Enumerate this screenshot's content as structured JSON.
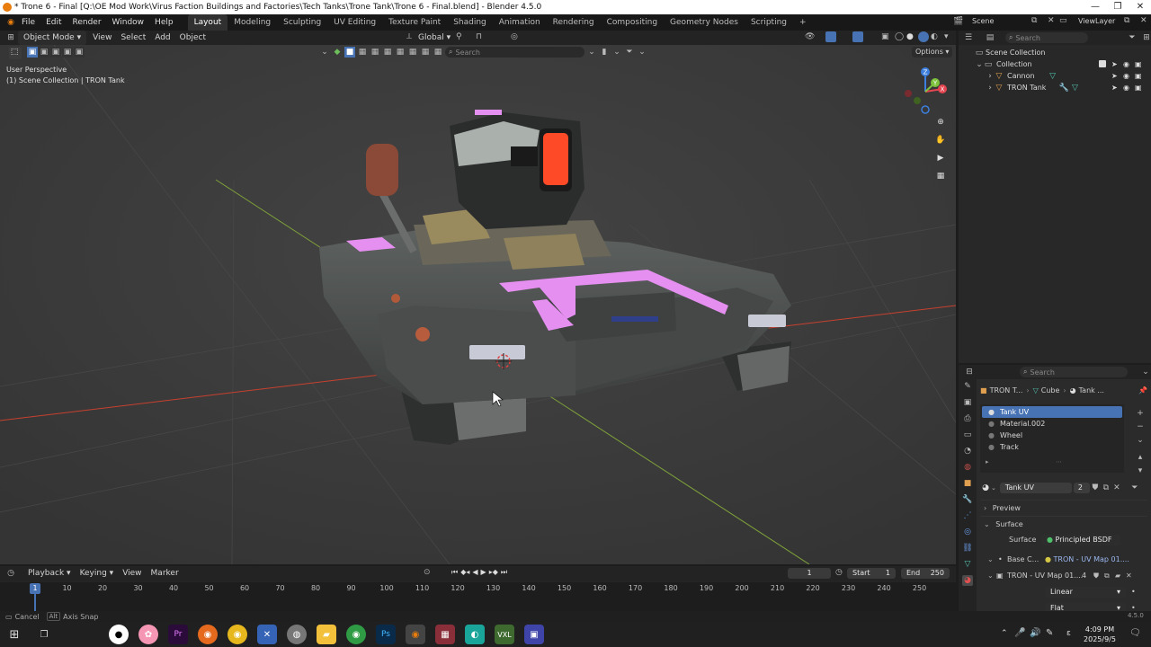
{
  "window": {
    "title": "* Trone 6 - Final [Q:\\OE Mod Work\\Virus Faction Buildings and Factories\\Tech Tanks\\Trone Tank\\Trone 6 - Final.blend] - Blender 4.5.0"
  },
  "menu": [
    "File",
    "Edit",
    "Render",
    "Window",
    "Help"
  ],
  "workspaces": [
    "Layout",
    "Modeling",
    "Sculpting",
    "UV Editing",
    "Texture Paint",
    "Shading",
    "Animation",
    "Rendering",
    "Compositing",
    "Geometry Nodes",
    "Scripting"
  ],
  "active_workspace": "Layout",
  "scene_selector": {
    "scene": "Scene",
    "view_layer": "ViewLayer"
  },
  "viewport_header": {
    "mode": "Object Mode",
    "menus": [
      "View",
      "Select",
      "Add",
      "Object"
    ],
    "transform_orientation": "Global",
    "options": "Options",
    "search_placeholder": "Search"
  },
  "viewport_overlay": {
    "perspective": "User Perspective",
    "collection": "(1) Scene Collection | TRON Tank"
  },
  "gizmo_axes": [
    "Z",
    "Y",
    "X"
  ],
  "outliner": {
    "search_placeholder": "Search",
    "root": "Scene Collection",
    "collection": "Collection",
    "items": [
      "Cannon",
      "TRON Tank"
    ]
  },
  "properties": {
    "search_placeholder": "Search",
    "breadcrumb": [
      "TRON T...",
      "Cube",
      "Tank ..."
    ],
    "material_slots": [
      "Tank UV",
      "Material.002",
      "Wheel",
      "Track"
    ],
    "selected_slot": "Tank UV",
    "material_name": "Tank UV",
    "user_count": "2",
    "panels": {
      "preview": "Preview",
      "surface": "Surface"
    },
    "surface_label": "Surface",
    "surface_shader": "Principled BSDF",
    "base_color_label": "Base C...",
    "base_color_value": "TRON - UV Map 01....",
    "image_name": "TRON - UV Map 01....",
    "image_users": "4",
    "interpolation": "Linear",
    "projection": "Flat"
  },
  "timeline": {
    "menus": [
      "Playback",
      "Keying",
      "View",
      "Marker"
    ],
    "current_frame": "1",
    "start_label": "Start",
    "start": "1",
    "end_label": "End",
    "end": "250",
    "ruler_marks": [
      "10",
      "20",
      "30",
      "40",
      "50",
      "60",
      "70",
      "80",
      "90",
      "100",
      "110",
      "120",
      "130",
      "140",
      "150",
      "160",
      "170",
      "180",
      "190",
      "200",
      "210",
      "220",
      "230",
      "240",
      "250"
    ],
    "playhead": "1"
  },
  "statusbar": {
    "left": "Cancel",
    "hint_key": "Alt",
    "hint": "Axis Snap",
    "version": "4.5.0"
  },
  "taskbar": {
    "time": "4:09 PM",
    "date": "2025/9/5",
    "lang": "ε"
  },
  "colors": {
    "accent": "#4772b3",
    "pink": "#e58ff0",
    "tank_body": "#4f5352",
    "x_axis": "#c8402f",
    "y_axis": "#7ea03a",
    "gizmo_x": "#e54550",
    "gizmo_y": "#7ec23d",
    "gizmo_z": "#3d7fdd"
  }
}
